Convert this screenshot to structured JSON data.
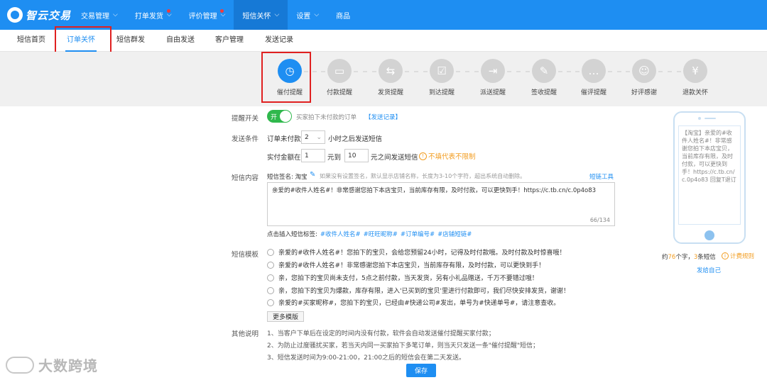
{
  "brand": {
    "name": "智云交易"
  },
  "topnav": [
    {
      "label": "交易管理",
      "chevron": true,
      "dot": false
    },
    {
      "label": "打单发货",
      "chevron": true,
      "dot": true
    },
    {
      "label": "评价管理",
      "chevron": true,
      "dot": true
    },
    {
      "label": "短信关怀",
      "chevron": true,
      "dot": false,
      "active": true
    },
    {
      "label": "设置",
      "chevron": true,
      "dot": false
    },
    {
      "label": "商品",
      "chevron": false,
      "dot": false
    }
  ],
  "subnav": [
    "短信首页",
    "订单关怀",
    "短信群发",
    "自由发送",
    "客户管理",
    "发送记录"
  ],
  "subnav_active": "订单关怀",
  "steps": [
    {
      "label": "催付提醒",
      "icon": "clock-icon",
      "glyph": "◷",
      "active": true
    },
    {
      "label": "付款提醒",
      "icon": "wallet-icon",
      "glyph": "▭"
    },
    {
      "label": "发货提醒",
      "icon": "truck-icon",
      "glyph": "⇆"
    },
    {
      "label": "到达提醒",
      "icon": "package-check-icon",
      "glyph": "☑"
    },
    {
      "label": "派送提醒",
      "icon": "delivery-icon",
      "glyph": "⇥"
    },
    {
      "label": "签收提醒",
      "icon": "sign-icon",
      "glyph": "✎"
    },
    {
      "label": "催评提醒",
      "icon": "comment-icon",
      "glyph": "…"
    },
    {
      "label": "好评感谢",
      "icon": "praise-icon",
      "glyph": "☺"
    },
    {
      "label": "退款关怀",
      "icon": "refund-icon",
      "glyph": "¥"
    }
  ],
  "form": {
    "switch_label": "提醒开关",
    "switch_on_text": "开",
    "switch_desc": "买家拍下未付款的订单",
    "send_log_link": "【发送记录】",
    "cond_label": "发送条件",
    "cond_prefix": "订单未付款",
    "hours_value": "2",
    "cond_suffix": "小时之后发送短信",
    "amount_prefix": "实付金额在",
    "amount_from": "1",
    "amount_mid": "元到",
    "amount_to": "10",
    "amount_suffix": "元之间发送短信",
    "amount_hint": "不填代表不限制",
    "content_label": "短信内容",
    "sign_prefix": "短信签名: 淘宝",
    "sign_hint": "如果没有设置签名，默认显示店铺名称，长度为3-10个字符，超出系统自动删除。",
    "short_link_tool": "短链工具",
    "message_text": "亲爱的#收件人姓名#！非常感谢您拍下本店宝贝，当前库存有限，及时付款，可以更快到手！https://c.tb.cn/c.0p4o83",
    "char_count": "66/134",
    "insert_label": "点击插入短信标签:",
    "tags": [
      "#收件人姓名#",
      "#旺旺昵称#",
      "#订单编号#",
      "#店铺短链#"
    ],
    "template_label": "短信模板",
    "templates": [
      "亲爱的#收件人姓名#！您拍下的宝贝，会给您预留24小时，记得及时付款哦。及时付款及时惊喜哦！",
      "亲爱的#收件人姓名#！非常感谢您拍下本店宝贝，当前库存有限，及时付款，可以更快到手！",
      "亲，您拍下的宝贝尚未支付，5点之前付款，当天发货，另有小礼品赠送，千万不要错过哦！",
      "亲，您拍下的宝贝为爆款，库存有限，进入'已买到的宝贝'里进行付款即可，我们尽快安排发货，谢谢！",
      "亲爱的#买家昵称#，您拍下的宝贝，已经由#快递公司#发出，单号为#快递单号#，请注意查收。"
    ],
    "more_templates": "更多模版",
    "notes_label": "其他说明",
    "notes": [
      "1、当客户下单后在设定的时间内没有付款，软件会自动发送催付提醒买家付款；",
      "2、为防止过度骚扰买家，若当天内同一买家拍下多笔订单，则当天只发送一条\"催付提醒\"短信；",
      "3、短信发送时间为9:00-21:00，21:00之后的短信会在第二天发送。"
    ],
    "save_label": "保存"
  },
  "preview": {
    "text": "【淘宝】亲爱的#收件人姓名#！非常感谢您拍下本店宝贝，当前库存有限，及时付款，可以更快到手！https://c.tb.cn/c.0p4o83 回复T退订",
    "count_prefix": "约",
    "count_chars": "76",
    "count_mid": "个字，",
    "count_sms": "3",
    "count_suffix": "条短信",
    "billing_rule": "计费规则",
    "send_self": "发给自己"
  },
  "watermark": "大数跨境",
  "colors": {
    "primary": "#1e8ef2",
    "switch_on": "#2fb84c",
    "highlight_box": "#e02020",
    "warning": "#f29c1f"
  }
}
